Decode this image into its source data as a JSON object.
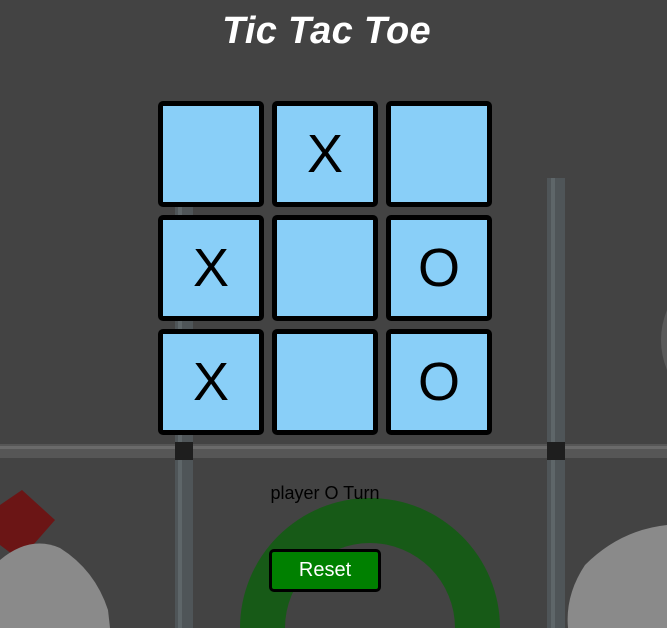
{
  "page": {
    "title": "Tic Tac Toe"
  },
  "board": {
    "cells": [
      {
        "value": ""
      },
      {
        "value": "X"
      },
      {
        "value": ""
      },
      {
        "value": "X"
      },
      {
        "value": ""
      },
      {
        "value": "O"
      },
      {
        "value": "X"
      },
      {
        "value": ""
      },
      {
        "value": "O"
      }
    ]
  },
  "status": {
    "text": "player O Turn"
  },
  "controls": {
    "reset_label": "Reset"
  },
  "colors": {
    "background": "#434343",
    "cell": "#89cff8",
    "reset_button": "#008000"
  }
}
